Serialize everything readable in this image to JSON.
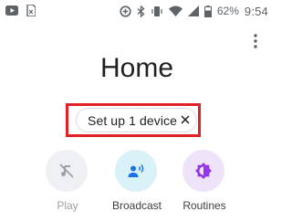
{
  "status_bar": {
    "battery": "62%",
    "time": "9:54"
  },
  "header": {
    "title": "Home",
    "menu_icon": "more-vert-icon"
  },
  "setup_chip": {
    "label": "Set up 1 device",
    "close_icon": "close-icon",
    "highlight_color": "#e02128"
  },
  "actions": [
    {
      "label": "Play",
      "icon": "music-off-icon",
      "circle_color": "#eef0f3",
      "icon_color": "#9aa0a6",
      "label_color": "#9aa0a6"
    },
    {
      "label": "Broadcast",
      "icon": "broadcast-icon",
      "circle_color": "#d9f2f7",
      "icon_color": "#1a73e8",
      "label_color": "#3c4043"
    },
    {
      "label": "Routines",
      "icon": "routines-icon",
      "circle_color": "#efe3fa",
      "icon_color": "#9334e6",
      "label_color": "#3c4043"
    }
  ]
}
